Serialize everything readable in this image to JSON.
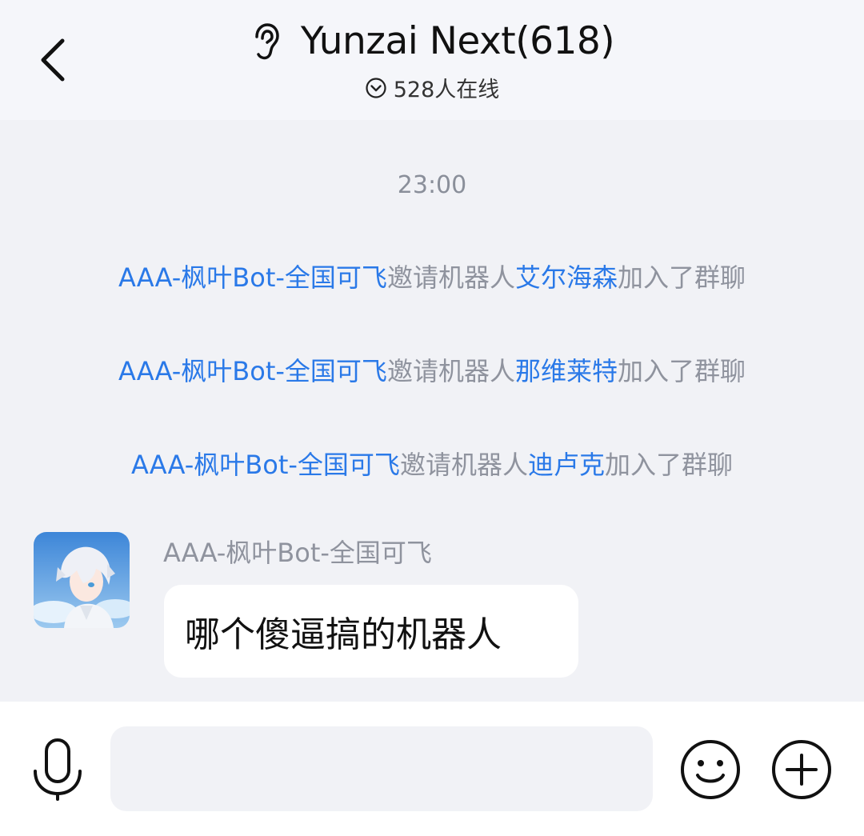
{
  "header": {
    "title": "Yunzai Next(618)",
    "online_count": "528人在线",
    "back_icon": "chevron-left-icon",
    "listen_icon": "ear-icon",
    "online_icon": "chevron-down-circle-icon"
  },
  "chat": {
    "time_label": "23:00",
    "system_messages": [
      {
        "inviter": "AAA-枫叶Bot-全国可飞",
        "action": "邀请机器人",
        "invitee": "艾尔海森",
        "result": "加入了群聊"
      },
      {
        "inviter": "AAA-枫叶Bot-全国可飞",
        "action": "邀请机器人",
        "invitee": "那维莱特",
        "result": "加入了群聊"
      },
      {
        "inviter": "AAA-枫叶Bot-全国可飞",
        "action": "邀请机器人",
        "invitee": "迪卢克",
        "result": "加入了群聊"
      }
    ],
    "message": {
      "sender": "AAA-枫叶Bot-全国可飞",
      "text": "哪个傻逼搞的机器人"
    }
  },
  "input_bar": {
    "value": "",
    "placeholder": "",
    "voice_icon": "microphone-icon",
    "emoji_icon": "smiley-icon",
    "plus_icon": "plus-circle-icon"
  },
  "colors": {
    "link": "#2a79e8",
    "muted": "#8f939e",
    "background": "#f1f2f6"
  }
}
